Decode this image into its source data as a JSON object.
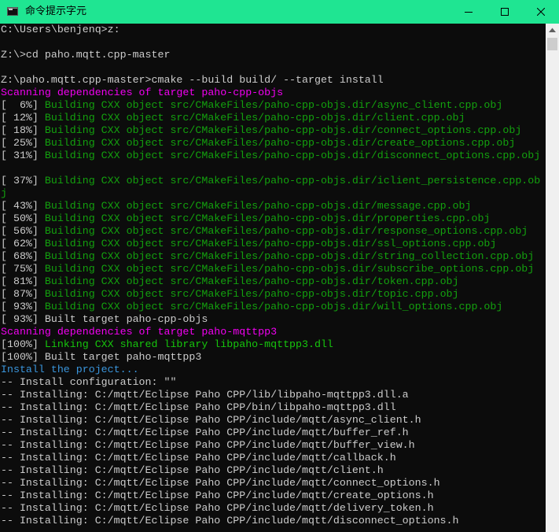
{
  "window": {
    "title": "命令提示字元",
    "colors": {
      "titlebar": "#1fe592",
      "console_bg": "#0c0c0c"
    },
    "icons": {
      "app": "console-app-icon",
      "minimize": "minimize-icon",
      "maximize": "maximize-icon",
      "close": "close-icon",
      "scroll_up": "scroll-up-arrow-icon"
    }
  },
  "console": {
    "lines": [
      {
        "text": "C:\\Users\\benjenq>z:",
        "color": "gray"
      },
      {
        "text": "",
        "color": "gray"
      },
      {
        "text": "Z:\\>cd paho.mqtt.cpp-master",
        "color": "gray"
      },
      {
        "text": "",
        "color": "gray"
      },
      {
        "text": "Z:\\paho.mqtt.cpp-master>cmake --build build/ --target install",
        "color": "gray"
      },
      {
        "text": "Scanning dependencies of target paho-cpp-objs",
        "color": "magenta"
      },
      {
        "prefix": "[  6%] ",
        "text": "Building CXX object src/CMakeFiles/paho-cpp-objs.dir/async_client.cpp.obj",
        "color": "green"
      },
      {
        "prefix": "[ 12%] ",
        "text": "Building CXX object src/CMakeFiles/paho-cpp-objs.dir/client.cpp.obj",
        "color": "green"
      },
      {
        "prefix": "[ 18%] ",
        "text": "Building CXX object src/CMakeFiles/paho-cpp-objs.dir/connect_options.cpp.obj",
        "color": "green"
      },
      {
        "prefix": "[ 25%] ",
        "text": "Building CXX object src/CMakeFiles/paho-cpp-objs.dir/create_options.cpp.obj",
        "color": "green"
      },
      {
        "prefix": "[ 31%] ",
        "text": "Building CXX object src/CMakeFiles/paho-cpp-objs.dir/disconnect_options.cpp.obj",
        "color": "green"
      },
      {
        "text": "",
        "color": "gray"
      },
      {
        "prefix": "[ 37%] ",
        "text": "Building CXX object src/CMakeFiles/paho-cpp-objs.dir/iclient_persistence.cpp.ob",
        "color": "green"
      },
      {
        "text": "j",
        "color": "green"
      },
      {
        "prefix": "[ 43%] ",
        "text": "Building CXX object src/CMakeFiles/paho-cpp-objs.dir/message.cpp.obj",
        "color": "green"
      },
      {
        "prefix": "[ 50%] ",
        "text": "Building CXX object src/CMakeFiles/paho-cpp-objs.dir/properties.cpp.obj",
        "color": "green"
      },
      {
        "prefix": "[ 56%] ",
        "text": "Building CXX object src/CMakeFiles/paho-cpp-objs.dir/response_options.cpp.obj",
        "color": "green"
      },
      {
        "prefix": "[ 62%] ",
        "text": "Building CXX object src/CMakeFiles/paho-cpp-objs.dir/ssl_options.cpp.obj",
        "color": "green"
      },
      {
        "prefix": "[ 68%] ",
        "text": "Building CXX object src/CMakeFiles/paho-cpp-objs.dir/string_collection.cpp.obj",
        "color": "green"
      },
      {
        "prefix": "[ 75%] ",
        "text": "Building CXX object src/CMakeFiles/paho-cpp-objs.dir/subscribe_options.cpp.obj",
        "color": "green"
      },
      {
        "prefix": "[ 81%] ",
        "text": "Building CXX object src/CMakeFiles/paho-cpp-objs.dir/token.cpp.obj",
        "color": "green"
      },
      {
        "prefix": "[ 87%] ",
        "text": "Building CXX object src/CMakeFiles/paho-cpp-objs.dir/topic.cpp.obj",
        "color": "green"
      },
      {
        "prefix": "[ 93%] ",
        "text": "Building CXX object src/CMakeFiles/paho-cpp-objs.dir/will_options.cpp.obj",
        "color": "green"
      },
      {
        "text": "[ 93%] Built target paho-cpp-objs",
        "color": "gray"
      },
      {
        "text": "Scanning dependencies of target paho-mqttpp3",
        "color": "magenta"
      },
      {
        "prefix": "[100%] ",
        "text": "Linking CXX shared library libpaho-mqttpp3.dll",
        "color": "lime"
      },
      {
        "text": "[100%] Built target paho-mqttpp3",
        "color": "gray"
      },
      {
        "text": "Install the project...",
        "color": "cyan"
      },
      {
        "text": "-- Install configuration: \"\"",
        "color": "gray"
      },
      {
        "text": "-- Installing: C:/mqtt/Eclipse Paho CPP/lib/libpaho-mqttpp3.dll.a",
        "color": "gray"
      },
      {
        "text": "-- Installing: C:/mqtt/Eclipse Paho CPP/bin/libpaho-mqttpp3.dll",
        "color": "gray"
      },
      {
        "text": "-- Installing: C:/mqtt/Eclipse Paho CPP/include/mqtt/async_client.h",
        "color": "gray"
      },
      {
        "text": "-- Installing: C:/mqtt/Eclipse Paho CPP/include/mqtt/buffer_ref.h",
        "color": "gray"
      },
      {
        "text": "-- Installing: C:/mqtt/Eclipse Paho CPP/include/mqtt/buffer_view.h",
        "color": "gray"
      },
      {
        "text": "-- Installing: C:/mqtt/Eclipse Paho CPP/include/mqtt/callback.h",
        "color": "gray"
      },
      {
        "text": "-- Installing: C:/mqtt/Eclipse Paho CPP/include/mqtt/client.h",
        "color": "gray"
      },
      {
        "text": "-- Installing: C:/mqtt/Eclipse Paho CPP/include/mqtt/connect_options.h",
        "color": "gray"
      },
      {
        "text": "-- Installing: C:/mqtt/Eclipse Paho CPP/include/mqtt/create_options.h",
        "color": "gray"
      },
      {
        "text": "-- Installing: C:/mqtt/Eclipse Paho CPP/include/mqtt/delivery_token.h",
        "color": "gray"
      },
      {
        "text": "-- Installing: C:/mqtt/Eclipse Paho CPP/include/mqtt/disconnect_options.h",
        "color": "gray"
      }
    ]
  }
}
